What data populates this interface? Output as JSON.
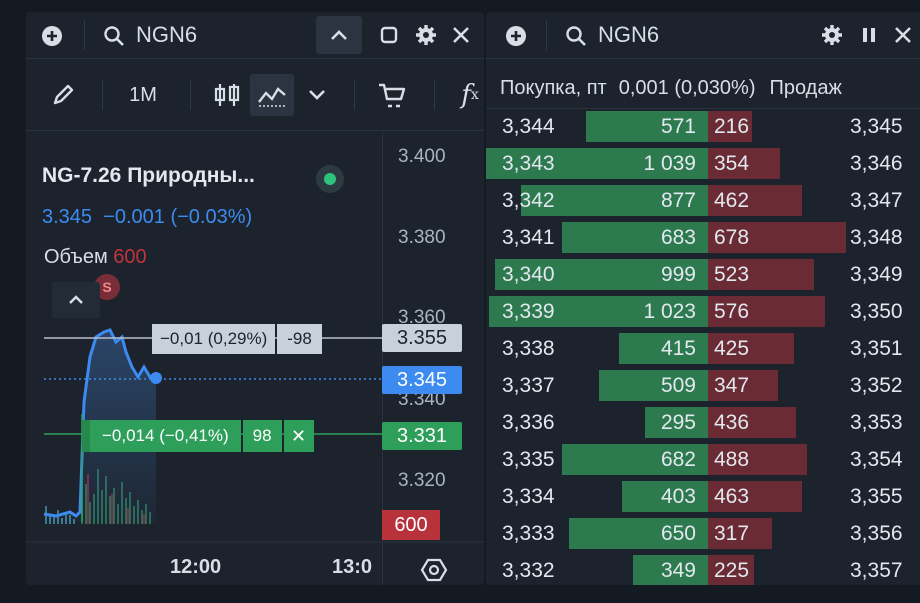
{
  "left": {
    "ticker": "NGN6",
    "timeframe": "1M",
    "instrument_name": "NG-7.26 Природны...",
    "price_line": "3.345  −0.001 (−0.03%)",
    "volume_label": "Объем",
    "volume_value": "600",
    "marker_s": "S",
    "order1_text": "−0,01 (0,29%)",
    "order1_qty": "-98",
    "order2_text": "−0,014 (−0,41%)",
    "order2_qty": "98",
    "order2_close": "✕",
    "axis_labels": [
      "3.400",
      "3.380",
      "3.360",
      "3.340",
      "3.320"
    ],
    "tag_top": "3.355",
    "tag_current": "3.345",
    "tag_green": "3.331",
    "tag_volume": "600",
    "time_labels": [
      "12:00",
      "13:0"
    ]
  },
  "right": {
    "ticker": "NGN6",
    "header_buy": "Покупка, пт",
    "header_spread": "0,001 (0,030%)",
    "header_sell": "Продаж",
    "rows": [
      {
        "bp": "3,344",
        "bq": "571",
        "aq": "216",
        "ap": "3,345"
      },
      {
        "bp": "3,343",
        "bq": "1 039",
        "aq": "354",
        "ap": "3,346"
      },
      {
        "bp": "3,342",
        "bq": "877",
        "aq": "462",
        "ap": "3,347"
      },
      {
        "bp": "3,341",
        "bq": "683",
        "aq": "678",
        "ap": "3,348"
      },
      {
        "bp": "3,340",
        "bq": "999",
        "aq": "523",
        "ap": "3,349"
      },
      {
        "bp": "3,339",
        "bq": "1 023",
        "aq": "576",
        "ap": "3,350"
      },
      {
        "bp": "3,338",
        "bq": "415",
        "aq": "425",
        "ap": "3,351"
      },
      {
        "bp": "3,337",
        "bq": "509",
        "aq": "347",
        "ap": "3,352"
      },
      {
        "bp": "3,336",
        "bq": "295",
        "aq": "436",
        "ap": "3,353"
      },
      {
        "bp": "3,335",
        "bq": "682",
        "aq": "488",
        "ap": "3,354"
      },
      {
        "bp": "3,334",
        "bq": "403",
        "aq": "463",
        "ap": "3,355"
      },
      {
        "bp": "3,333",
        "bq": "650",
        "aq": "317",
        "ap": "3,356"
      },
      {
        "bp": "3,332",
        "bq": "349",
        "aq": "225",
        "ap": "3,357"
      }
    ]
  },
  "colors": {
    "green": "#2e9e5b",
    "red": "#c0343f",
    "blue": "#3d8bf0"
  }
}
